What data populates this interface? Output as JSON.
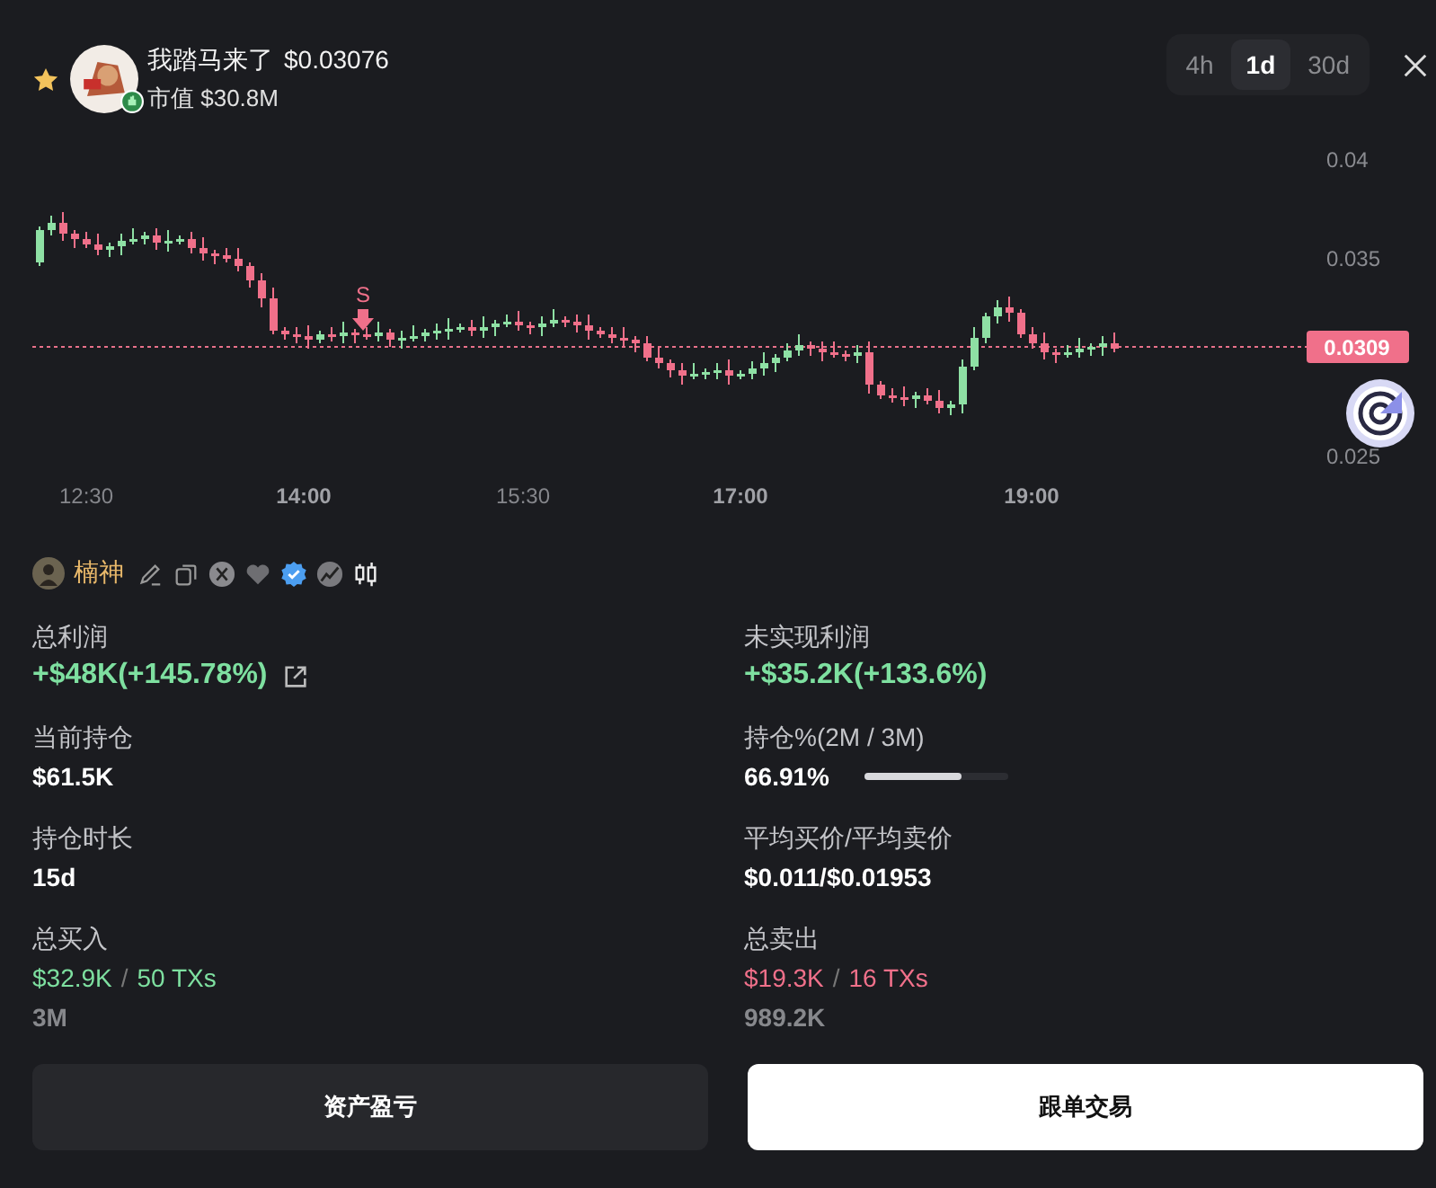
{
  "token": {
    "name": "我踏马来了",
    "price": "$0.03076",
    "market_cap": "市值 $30.8M",
    "favorite": true
  },
  "timeframes": [
    {
      "label": "4h",
      "selected": false
    },
    {
      "label": "1d",
      "selected": true
    },
    {
      "label": "30d",
      "selected": false
    }
  ],
  "chart": {
    "y_labels": [
      "0.04",
      "0.035",
      "0.025"
    ],
    "x_labels": [
      {
        "label": "12:30",
        "major": false
      },
      {
        "label": "14:00",
        "major": true
      },
      {
        "label": "15:30",
        "major": false
      },
      {
        "label": "17:00",
        "major": true
      },
      {
        "label": "19:00",
        "major": true
      }
    ],
    "current_price": "0.0309",
    "trade_marker": "S"
  },
  "trader": {
    "name": "楠神",
    "verified": true
  },
  "stats": [
    {
      "kind": "profit",
      "label": "总利润",
      "value": "+$48K(+145.78%)",
      "link": true
    },
    {
      "kind": "profit",
      "label": "未实现利润",
      "value": "+$35.2K(+133.6%)",
      "link": false
    },
    {
      "kind": "plain",
      "label": "当前持仓",
      "value": "$61.5K"
    },
    {
      "kind": "progress",
      "label": "持仓%(2M / 3M)",
      "value": "66.91%",
      "level": 0.6691
    },
    {
      "kind": "plain",
      "label": "持仓时长",
      "value": "15d"
    },
    {
      "kind": "plain",
      "label": "平均买价/平均卖价",
      "value": "$0.011/$0.01953"
    },
    {
      "kind": "trade",
      "label": "总买入",
      "amount": "$32.9K",
      "separator": "/",
      "txs": "50 TXs",
      "color": "#7ee0a0",
      "volume": "3M"
    },
    {
      "kind": "trade",
      "label": "总卖出",
      "amount": "$19.3K",
      "separator": "/",
      "txs": "16 TXs",
      "color": "#f0708a",
      "volume": "989.2K"
    }
  ],
  "buttons": [
    {
      "label": "资产盈亏",
      "primary": false
    },
    {
      "label": "跟单交易",
      "primary": true
    }
  ]
}
